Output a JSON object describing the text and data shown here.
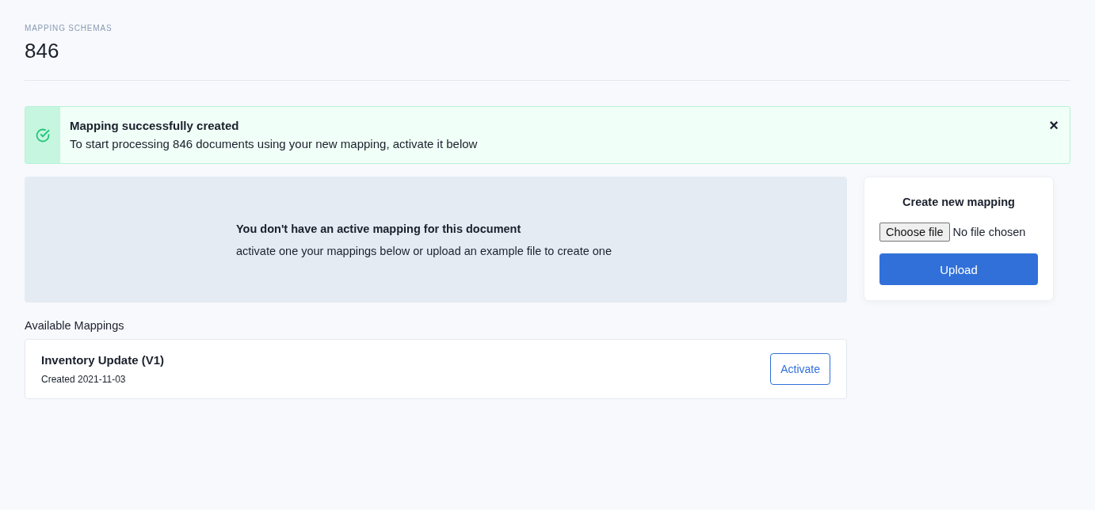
{
  "header": {
    "eyebrow": "MAPPING SCHEMAS",
    "title": "846"
  },
  "alert": {
    "title": "Mapping successfully created",
    "message": "To start processing 846 documents using your new mapping, activate it below",
    "close": "×"
  },
  "empty_state": {
    "title": "You don't have an active mapping for this document",
    "message": "activate one your mappings below or upload an example file to create one"
  },
  "available": {
    "heading": "Available Mappings",
    "items": [
      {
        "name": "Inventory Update (V1)",
        "created": "Created 2021-11-03",
        "action": "Activate"
      }
    ]
  },
  "upload_card": {
    "title": "Create new mapping",
    "choose_button": "Choose file",
    "file_status": "No file chosen",
    "upload_button": "Upload"
  }
}
